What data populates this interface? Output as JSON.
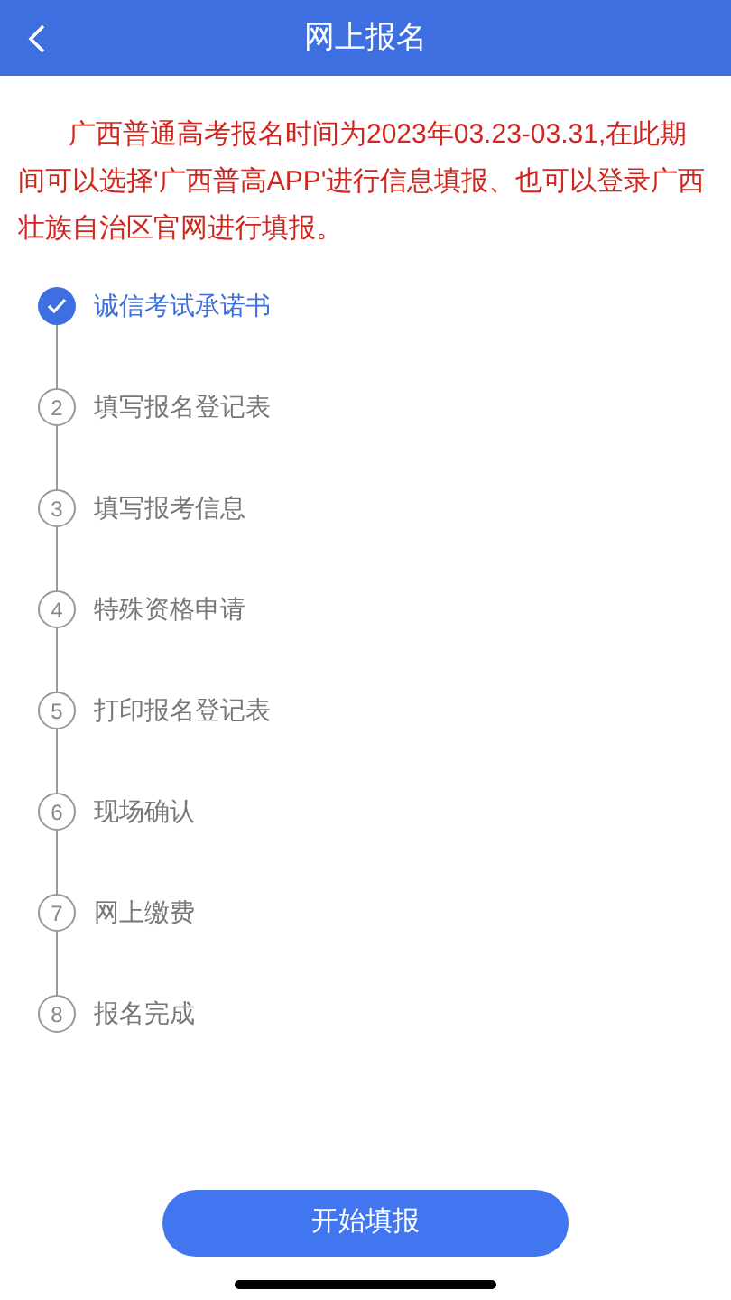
{
  "header": {
    "title": "网上报名"
  },
  "notice": "广西普通高考报名时间为2023年03.23-03.31,在此期间可以选择'广西普高APP'进行信息填报、也可以登录广西壮族自治区官网进行填报。",
  "steps": [
    {
      "label": "诚信考试承诺书",
      "done": true
    },
    {
      "number": "2",
      "label": "填写报名登记表",
      "done": false
    },
    {
      "number": "3",
      "label": "填写报考信息",
      "done": false
    },
    {
      "number": "4",
      "label": "特殊资格申请",
      "done": false
    },
    {
      "number": "5",
      "label": "打印报名登记表",
      "done": false
    },
    {
      "number": "6",
      "label": "现场确认",
      "done": false
    },
    {
      "number": "7",
      "label": "网上缴费",
      "done": false
    },
    {
      "number": "8",
      "label": "报名完成",
      "done": false
    }
  ],
  "button": "开始填报"
}
